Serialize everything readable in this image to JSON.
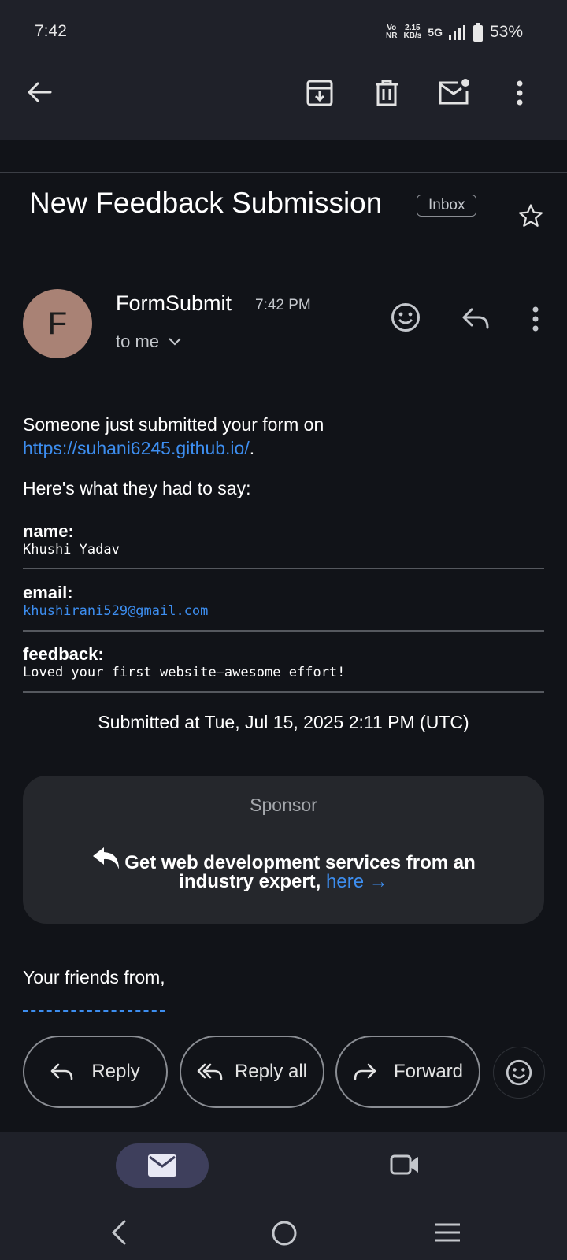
{
  "status_bar": {
    "time": "7:42",
    "volte": "Vo\nNR",
    "speed_value": "2.15",
    "speed_unit": "KB/s",
    "network": "5G",
    "battery": "53%"
  },
  "app_bar": {
    "icons": [
      "back-arrow-icon",
      "archive-icon",
      "delete-icon",
      "mark-unread-icon",
      "more-vert-icon"
    ]
  },
  "email": {
    "subject": "New Feedback Submission",
    "label": "Inbox",
    "sender_initial": "F",
    "sender": "FormSubmit",
    "time": "7:42 PM",
    "recipient": "to me",
    "intro": "Someone just submitted your form on",
    "intro_link": "https://suhani6245.github.io/",
    "intro_end": ".",
    "lead": "Here's what they had to say:",
    "fields": [
      {
        "label": "name:",
        "value": "Khushi Yadav"
      },
      {
        "label": "email:",
        "value": "khushirani529@gmail.com"
      },
      {
        "label": "feedback:",
        "value": "Loved your first website—awesome effort!"
      }
    ],
    "submitted": "Submitted at Tue, Jul 15, 2025 2:11 PM (UTC)",
    "sponsor": {
      "title": "Sponsor",
      "line1": "Get web development services from an",
      "line2_text": "industry expert,",
      "line2_link": "here →"
    },
    "closing": "Your friends from,"
  },
  "actions": {
    "reply": "Reply",
    "reply_all": "Reply all",
    "forward": "Forward"
  },
  "colors": {
    "background": "#111318",
    "surface": "#1f2129",
    "link": "#3d8ef0",
    "avatar": "#a98275",
    "active_pill": "#3e3f5c"
  }
}
